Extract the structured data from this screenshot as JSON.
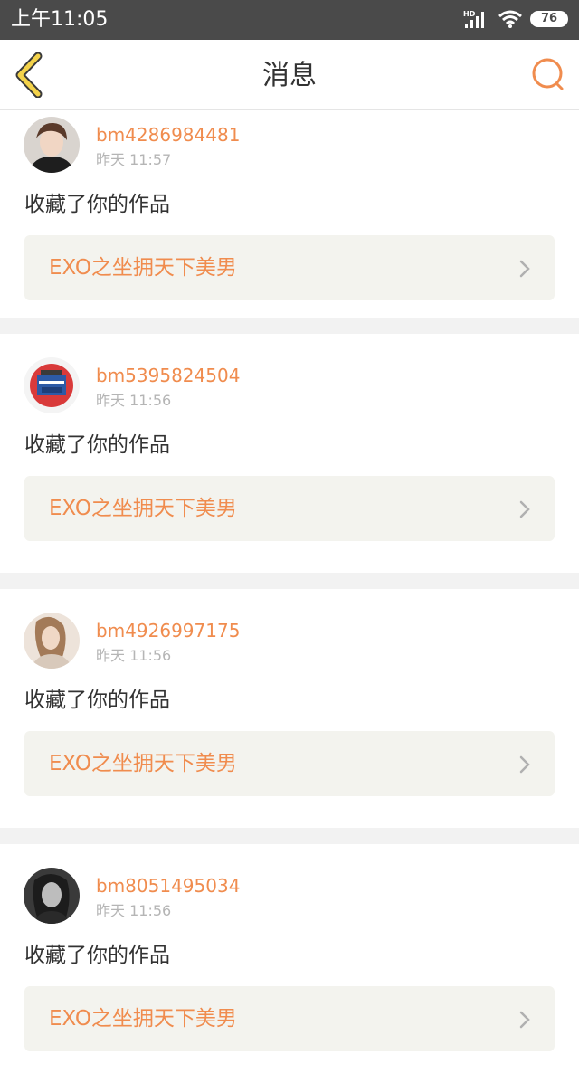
{
  "status_bar": {
    "time": "上午11:05",
    "network_badge": "HD",
    "battery_level": "76"
  },
  "header": {
    "title": "消息",
    "back_icon": "chevron-left-icon",
    "search_icon": "search-icon"
  },
  "colors": {
    "accent": "#f08c4e",
    "back_icon_fill": "#f4d34a",
    "status_bar_bg": "#4a4a4a",
    "link_bg": "#f3f3ee"
  },
  "messages": [
    {
      "username": "bm4286984481",
      "time": "昨天 11:57",
      "action": "收藏了你的作品",
      "work_title": "EXO之坐拥天下美男"
    },
    {
      "username": "bm5395824504",
      "time": "昨天 11:56",
      "action": "收藏了你的作品",
      "work_title": "EXO之坐拥天下美男"
    },
    {
      "username": "bm4926997175",
      "time": "昨天 11:56",
      "action": "收藏了你的作品",
      "work_title": "EXO之坐拥天下美男"
    },
    {
      "username": "bm8051495034",
      "time": "昨天 11:56",
      "action": "收藏了你的作品",
      "work_title": "EXO之坐拥天下美男"
    }
  ]
}
